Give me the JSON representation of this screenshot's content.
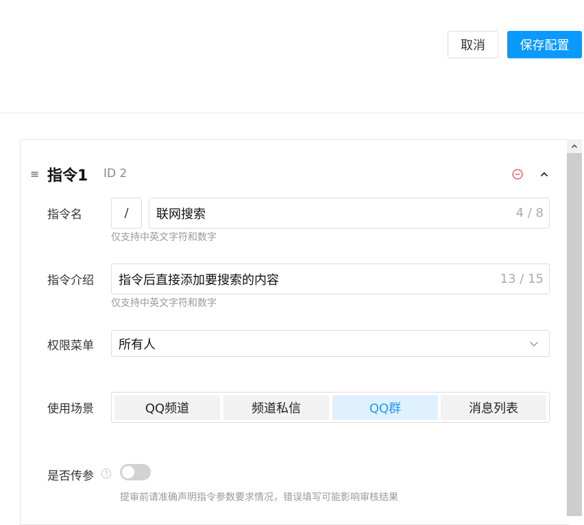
{
  "header": {
    "cancel_label": "取消",
    "save_label": "保存配置"
  },
  "command": {
    "title": "指令1",
    "id_text": "ID 2",
    "drag_glyph": "≡",
    "name": {
      "label": "指令名",
      "prefix": "/",
      "value": "联网搜索",
      "count": "4 / 8",
      "hint": "仅支持中英文字符和数字"
    },
    "description": {
      "label": "指令介绍",
      "value": "指令后直接添加要搜索的内容",
      "count": "13 / 15",
      "hint": "仅支持中英文字符和数字"
    },
    "permission": {
      "label": "权限菜单",
      "selected": "所有人"
    },
    "scenes": {
      "label": "使用场景",
      "options": [
        "QQ频道",
        "频道私信",
        "QQ群",
        "消息列表"
      ],
      "active_index": 2
    },
    "params": {
      "label": "是否传参",
      "enabled": false,
      "hint": "提审前请准确声明指令参数要求情况，错误填写可能影响审核结果"
    }
  },
  "icons": {
    "remove": "remove-circle-icon",
    "collapse": "chevron-up-icon",
    "dropdown": "chevron-down-icon",
    "help": "question-circle-icon",
    "scroll_up": "scroll-up-arrow-icon"
  },
  "colors": {
    "primary": "#0a99ff",
    "active_bg": "#dff1ff",
    "danger": "#e8505b"
  }
}
